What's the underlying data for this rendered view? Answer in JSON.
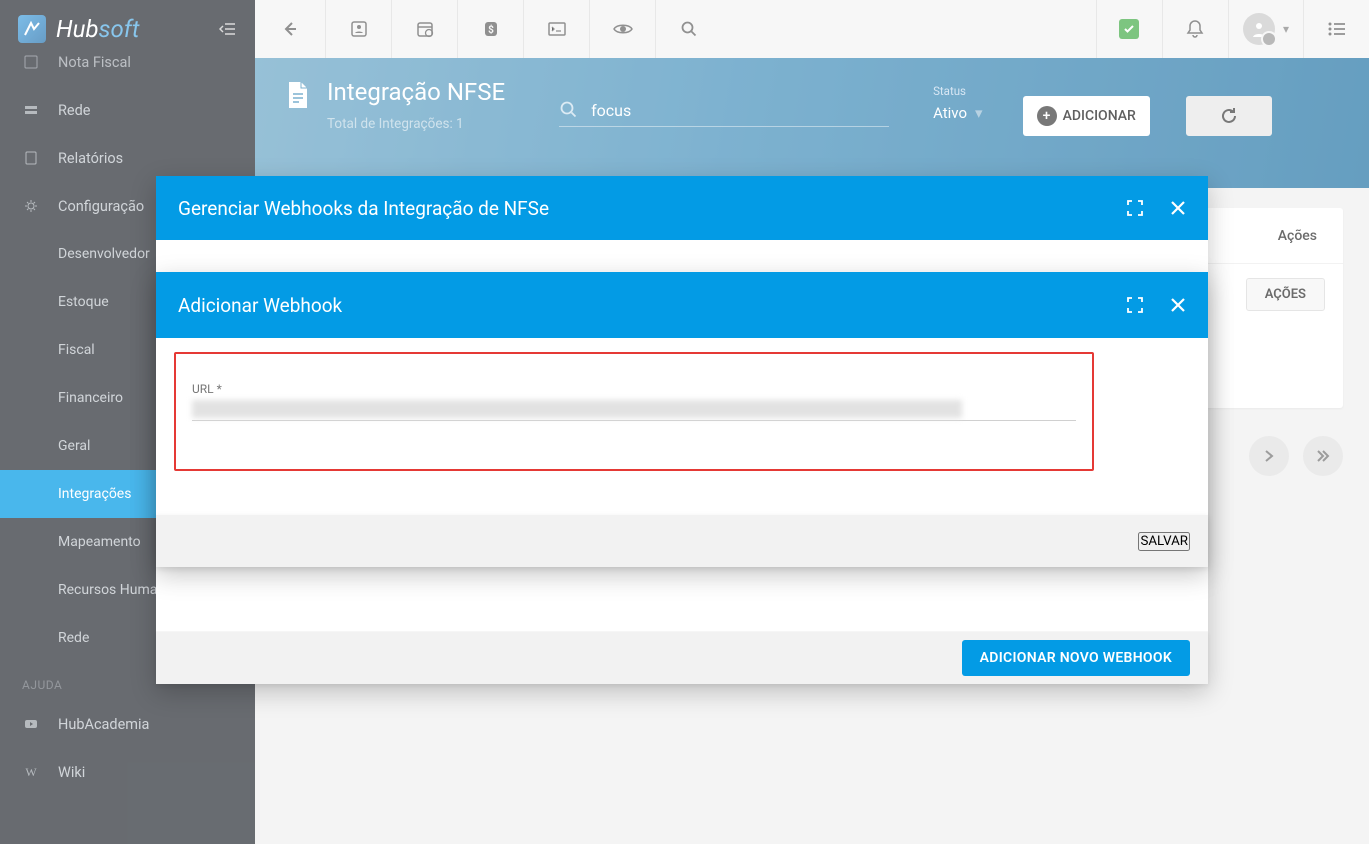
{
  "brand": {
    "hub": "Hub",
    "soft": "soft"
  },
  "sidebar": {
    "truncated_top": "Nota Fiscal",
    "items": [
      {
        "label": "Rede",
        "icon": "network-icon"
      },
      {
        "label": "Relatórios",
        "icon": "report-icon"
      },
      {
        "label": "Configuração",
        "icon": "gear-icon"
      }
    ],
    "sub": [
      {
        "label": "Desenvolvedor"
      },
      {
        "label": "Estoque"
      },
      {
        "label": "Fiscal"
      },
      {
        "label": "Financeiro"
      },
      {
        "label": "Geral"
      },
      {
        "label": "Integrações",
        "active": true
      },
      {
        "label": "Mapeamento"
      },
      {
        "label": "Recursos Huma"
      },
      {
        "label": "Rede"
      }
    ],
    "section_help": "AJUDA",
    "help": [
      {
        "label": "HubAcademia",
        "icon": "play-icon"
      },
      {
        "label": "Wiki",
        "icon": "wiki-icon"
      }
    ]
  },
  "banner": {
    "title": "Integração NFSE",
    "subtitle": "Total de Integrações: 1",
    "search_value": "focus",
    "status_label": "Status",
    "status_value": "Ativo",
    "add_button": "ADICIONAR"
  },
  "card": {
    "column_acoes": "Ações",
    "row_button": "AÇÕES"
  },
  "modal_manage": {
    "title": "Gerenciar Webhooks da Integração de NFSe",
    "footer_button": "ADICIONAR NOVO WEBHOOK"
  },
  "modal_add": {
    "title": "Adicionar Webhook",
    "url_label": "URL *",
    "save_button": "SALVAR"
  }
}
